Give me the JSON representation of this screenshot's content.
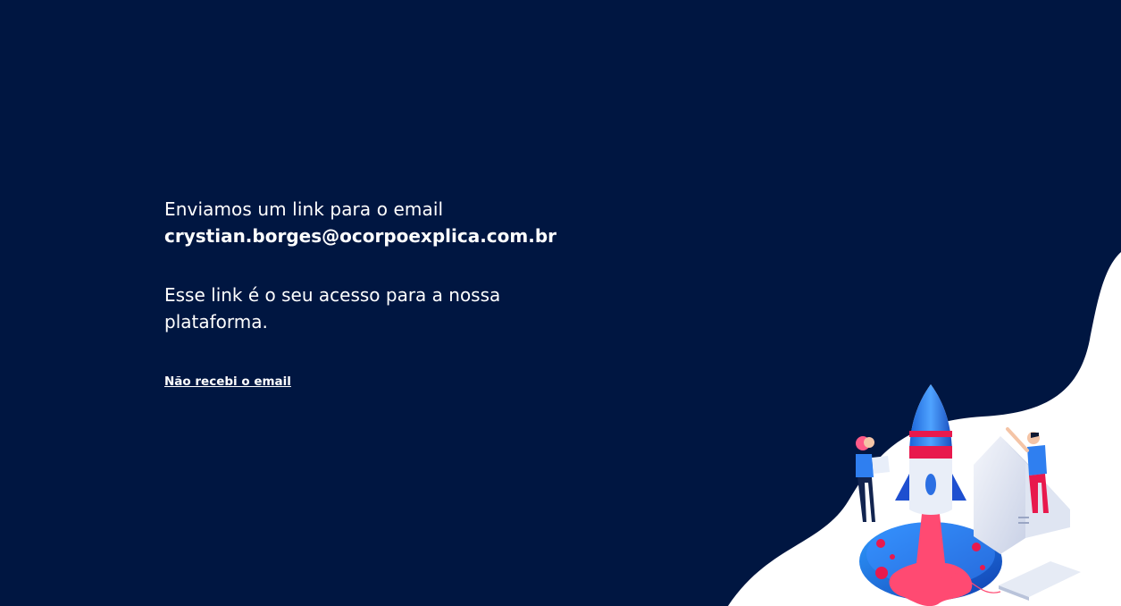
{
  "message": {
    "intro": "Enviamos um link para o email",
    "email": "crystian.borges@ocorpoexplica.com.br",
    "description": "Esse link é o seu acesso para a nossa plataforma.",
    "resend_link": "Não recebi o email"
  },
  "colors": {
    "background": "#001641",
    "wave": "#ffffff",
    "accent_pink": "#ff3d6e",
    "accent_blue": "#1e6fe6"
  },
  "illustration": {
    "subject": "rocket-launch-illustration"
  }
}
